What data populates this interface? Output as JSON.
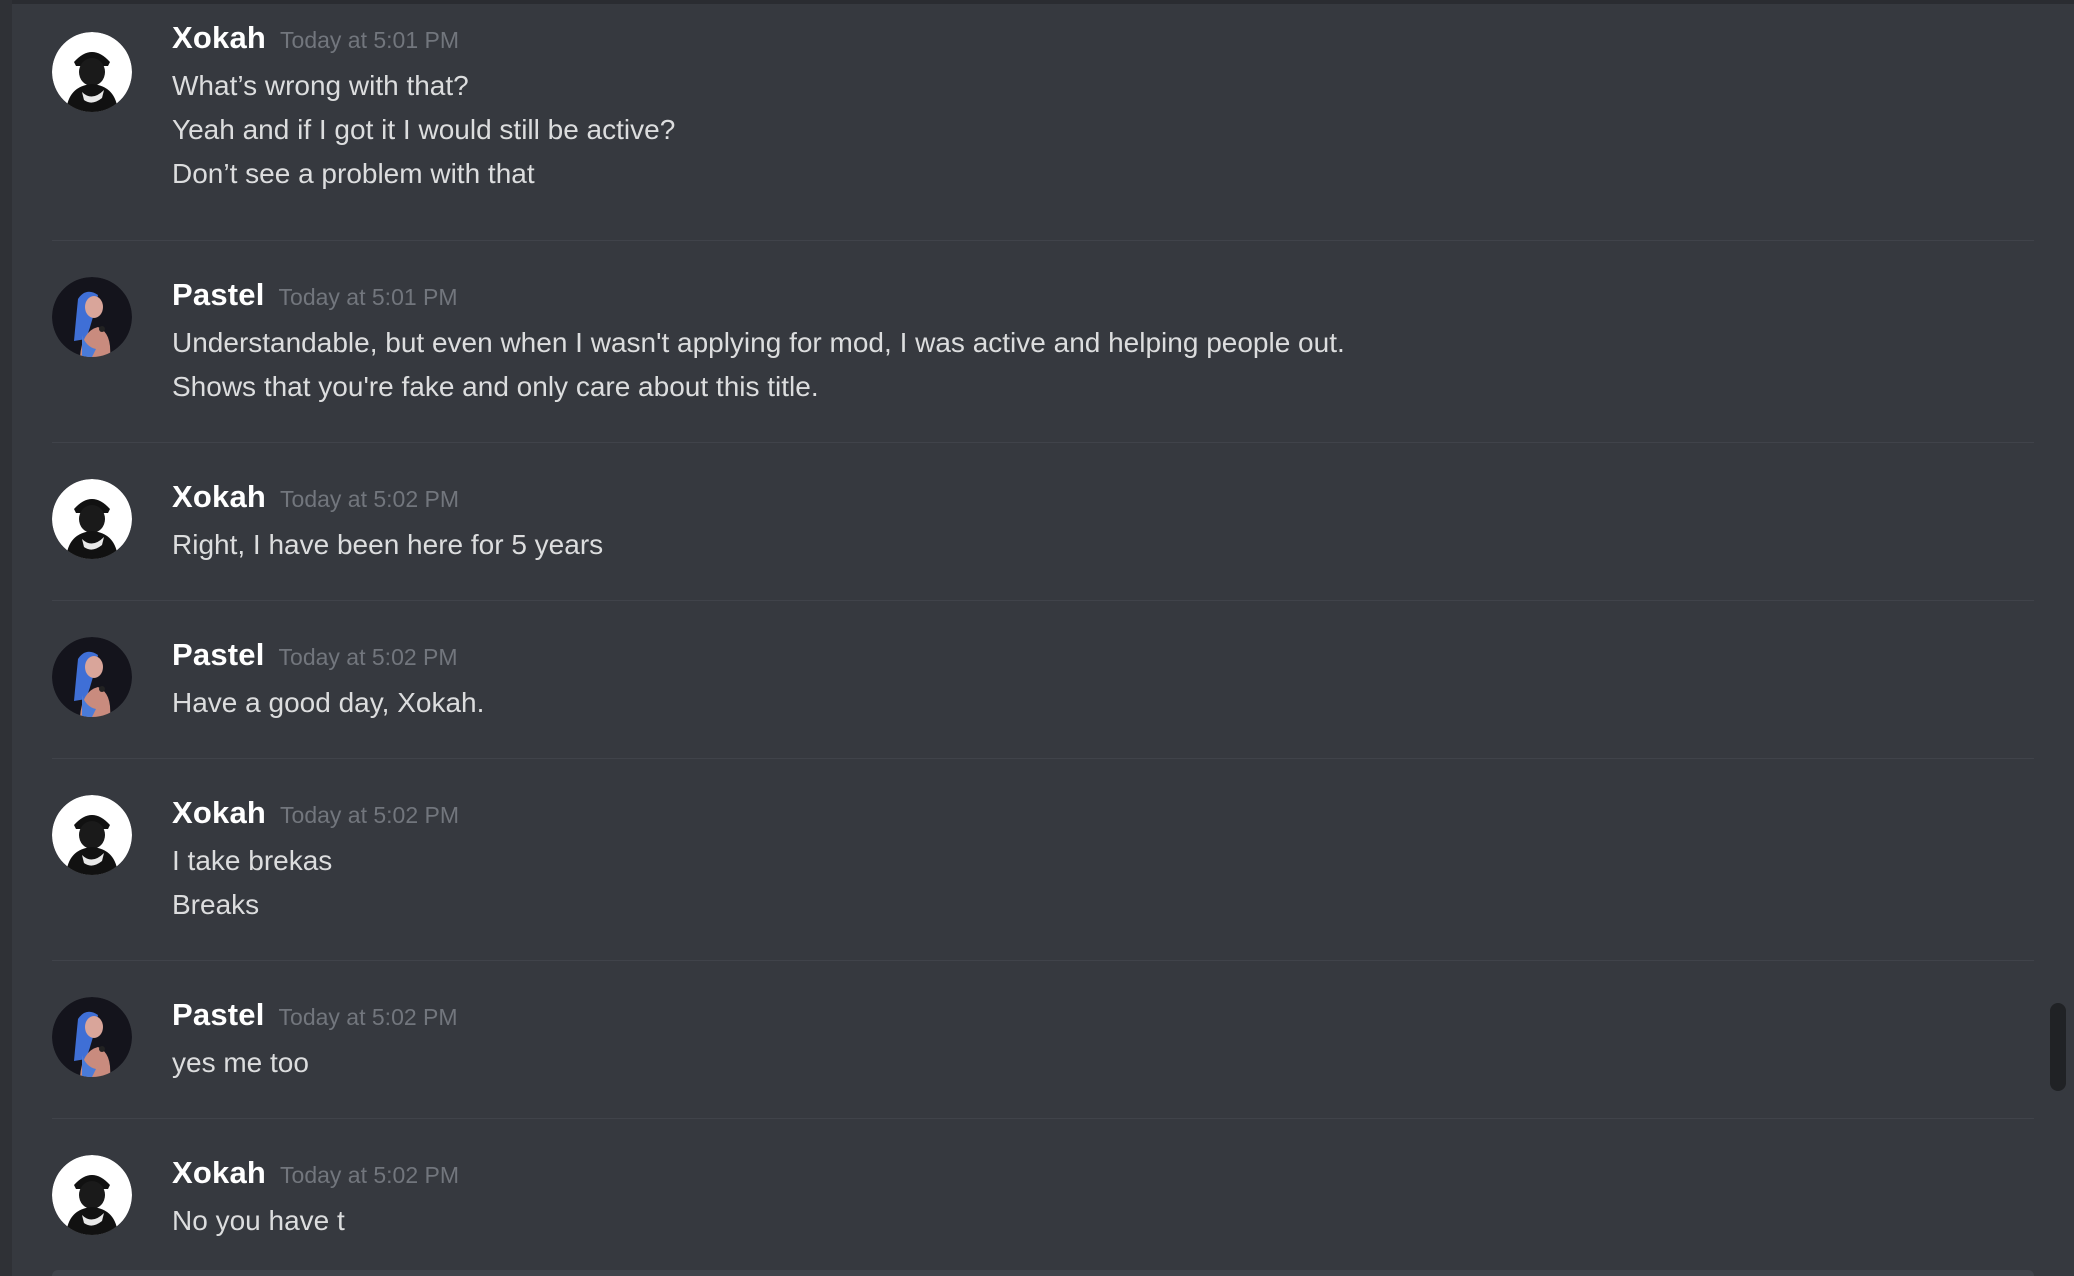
{
  "chat": {
    "messages": [
      {
        "author": "Xokah",
        "timestamp": "Today at 5:01 PM",
        "avatar_icon": "xokah-avatar-icon",
        "lines": [
          "What’s wrong with that?",
          "Yeah and if I got it I would still be active?",
          "Don’t see a problem with that"
        ]
      },
      {
        "author": "Pastel",
        "timestamp": "Today at 5:01 PM",
        "avatar_icon": "pastel-avatar-icon",
        "lines": [
          "Understandable, but even when I wasn't applying for mod, I was active and helping people out.",
          "Shows that you're fake and only care about this title."
        ]
      },
      {
        "author": "Xokah",
        "timestamp": "Today at 5:02 PM",
        "avatar_icon": "xokah-avatar-icon",
        "lines": [
          "Right, I have been here for 5 years"
        ]
      },
      {
        "author": "Pastel",
        "timestamp": "Today at 5:02 PM",
        "avatar_icon": "pastel-avatar-icon",
        "lines": [
          "Have a good day, Xokah."
        ]
      },
      {
        "author": "Xokah",
        "timestamp": "Today at 5:02 PM",
        "avatar_icon": "xokah-avatar-icon",
        "lines": [
          "I take brekas",
          "Breaks"
        ]
      },
      {
        "author": "Pastel",
        "timestamp": "Today at 5:02 PM",
        "avatar_icon": "pastel-avatar-icon",
        "lines": [
          "yes me too"
        ]
      },
      {
        "author": "Xokah",
        "timestamp": "Today at 5:02 PM",
        "avatar_icon": "xokah-avatar-icon",
        "lines": [
          "No you have t"
        ]
      }
    ]
  },
  "colors": {
    "background": "#36393f",
    "username": "#ffffff",
    "timestamp": "#72767d",
    "text": "#dcddde",
    "divider": "#40434a",
    "scrollbar_thumb": "#202225"
  }
}
